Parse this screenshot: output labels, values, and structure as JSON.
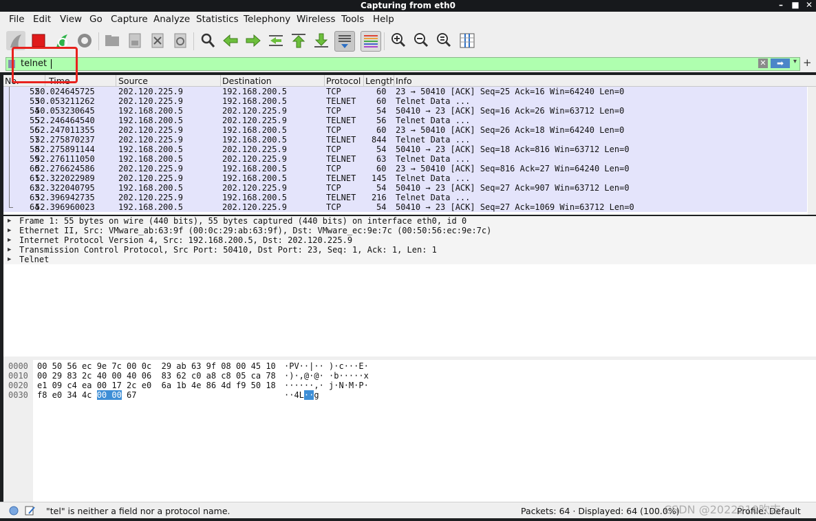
{
  "window": {
    "title": "Capturing from eth0",
    "min": "–",
    "max": "■",
    "close": "✕"
  },
  "menu": [
    "File",
    "Edit",
    "View",
    "Go",
    "Capture",
    "Analyze",
    "Statistics",
    "Telephony",
    "Wireless",
    "Tools",
    "Help"
  ],
  "toolbar": {
    "icons": [
      "shark-fin-start-icon",
      "stop-capture-icon",
      "restart-capture-icon",
      "capture-options-icon",
      "open-file-icon",
      "save-file-icon",
      "close-file-icon",
      "reload-file-icon",
      "find-packet-icon",
      "go-back-icon",
      "go-forward-icon",
      "go-to-packet-icon",
      "go-first-icon",
      "go-last-icon",
      "autoscroll-icon",
      "colorize-icon",
      "zoom-in-icon",
      "zoom-out-icon",
      "normal-size-icon",
      "resize-columns-icon"
    ]
  },
  "filter": {
    "value": "telnet",
    "clear": "✕",
    "apply": "➡",
    "dropdown": "▾",
    "add": "+"
  },
  "columns": [
    "No.",
    "Time",
    "Source",
    "Destination",
    "Protocol",
    "Length",
    "Info"
  ],
  "packets": [
    {
      "no": "52",
      "time": "50.024645725",
      "src": "202.120.225.9",
      "dst": "192.168.200.5",
      "proto": "TCP",
      "len": "60",
      "info": "23 → 50410 [ACK] Seq=25 Ack=16 Win=64240 Len=0"
    },
    {
      "no": "53",
      "time": "50.053211262",
      "src": "202.120.225.9",
      "dst": "192.168.200.5",
      "proto": "TELNET",
      "len": "60",
      "info": "Telnet Data ..."
    },
    {
      "no": "54",
      "time": "50.053230645",
      "src": "192.168.200.5",
      "dst": "202.120.225.9",
      "proto": "TCP",
      "len": "54",
      "info": "50410 → 23 [ACK] Seq=16 Ack=26 Win=63712 Len=0"
    },
    {
      "no": "55",
      "time": "52.246464540",
      "src": "192.168.200.5",
      "dst": "202.120.225.9",
      "proto": "TELNET",
      "len": "56",
      "info": "Telnet Data ..."
    },
    {
      "no": "56",
      "time": "52.247011355",
      "src": "202.120.225.9",
      "dst": "192.168.200.5",
      "proto": "TCP",
      "len": "60",
      "info": "23 → 50410 [ACK] Seq=26 Ack=18 Win=64240 Len=0"
    },
    {
      "no": "57",
      "time": "52.275870237",
      "src": "202.120.225.9",
      "dst": "192.168.200.5",
      "proto": "TELNET",
      "len": "844",
      "info": "Telnet Data ..."
    },
    {
      "no": "58",
      "time": "52.275891144",
      "src": "192.168.200.5",
      "dst": "202.120.225.9",
      "proto": "TCP",
      "len": "54",
      "info": "50410 → 23 [ACK] Seq=18 Ack=816 Win=63712 Len=0"
    },
    {
      "no": "59",
      "time": "52.276111050",
      "src": "192.168.200.5",
      "dst": "202.120.225.9",
      "proto": "TELNET",
      "len": "63",
      "info": "Telnet Data ..."
    },
    {
      "no": "60",
      "time": "52.276624586",
      "src": "202.120.225.9",
      "dst": "192.168.200.5",
      "proto": "TCP",
      "len": "60",
      "info": "23 → 50410 [ACK] Seq=816 Ack=27 Win=64240 Len=0"
    },
    {
      "no": "61",
      "time": "52.322022989",
      "src": "202.120.225.9",
      "dst": "192.168.200.5",
      "proto": "TELNET",
      "len": "145",
      "info": "Telnet Data ..."
    },
    {
      "no": "62",
      "time": "52.322040795",
      "src": "192.168.200.5",
      "dst": "202.120.225.9",
      "proto": "TCP",
      "len": "54",
      "info": "50410 → 23 [ACK] Seq=27 Ack=907 Win=63712 Len=0"
    },
    {
      "no": "63",
      "time": "52.396942735",
      "src": "202.120.225.9",
      "dst": "192.168.200.5",
      "proto": "TELNET",
      "len": "216",
      "info": "Telnet Data ..."
    },
    {
      "no": "64",
      "time": "52.396960023",
      "src": "192.168.200.5",
      "dst": "202.120.225.9",
      "proto": "TCP",
      "len": "54",
      "info": "50410 → 23 [ACK] Seq=27 Ack=1069 Win=63712 Len=0"
    }
  ],
  "details": [
    "Frame 1: 55 bytes on wire (440 bits), 55 bytes captured (440 bits) on interface eth0, id 0",
    "Ethernet II, Src: VMware_ab:63:9f (00:0c:29:ab:63:9f), Dst: VMware_ec:9e:7c (00:50:56:ec:9e:7c)",
    "Internet Protocol Version 4, Src: 192.168.200.5, Dst: 202.120.225.9",
    "Transmission Control Protocol, Src Port: 50410, Dst Port: 23, Seq: 1, Ack: 1, Len: 1",
    "Telnet"
  ],
  "bytes": [
    {
      "off": "0000",
      "hex": "00 50 56 ec 9e 7c 00 0c  29 ab 63 9f 08 00 45 10",
      "ascii": "·PV··|·· )·c···E·"
    },
    {
      "off": "0010",
      "hex": "00 29 83 2c 40 00 40 06  83 62 c0 a8 c8 05 ca 78",
      "ascii": "·)·,@·@· ·b·····x"
    },
    {
      "off": "0020",
      "hex": "e1 09 c4 ea 00 17 2c e0  6a 1b 4e 86 4d f9 50 18",
      "ascii": "······,· j·N·M·P·"
    },
    {
      "off": "0030",
      "hex_pre": "f8 e0 34 4c ",
      "hex_hl": "00 00",
      "hex_post": " 67",
      "ascii_pre": "··4L",
      "ascii_hl": "··",
      "ascii_post": "g"
    }
  ],
  "status": {
    "message": "\"tel\" is neither a field nor a protocol name.",
    "packets": "Packets: 64 · Displayed: 64 (100.0%)",
    "profile": "Profile: Default"
  },
  "watermark": "CSDN @2022210吹吉"
}
